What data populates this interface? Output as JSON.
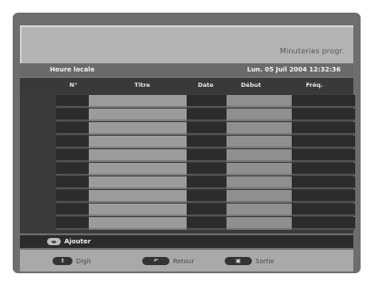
{
  "title": "Minuteries progr.",
  "info": {
    "left": "Heure locale",
    "right": "Lun. 05 Juil 2004  12:32:36"
  },
  "columns": [
    "N°",
    "Titre",
    "Date",
    "Début",
    "Fréq."
  ],
  "rows": [
    "",
    "",
    "",
    "",
    "",
    "",
    "",
    "",
    "",
    ""
  ],
  "action": {
    "icon": "colored-key-icon",
    "label": "Ajouter"
  },
  "footer": {
    "items": [
      {
        "icon": "digit-key-icon",
        "label": "Digit"
      },
      {
        "icon": "return-icon",
        "label": "Retour"
      },
      {
        "icon": "exit-key-icon",
        "label": "Sortie"
      }
    ]
  }
}
